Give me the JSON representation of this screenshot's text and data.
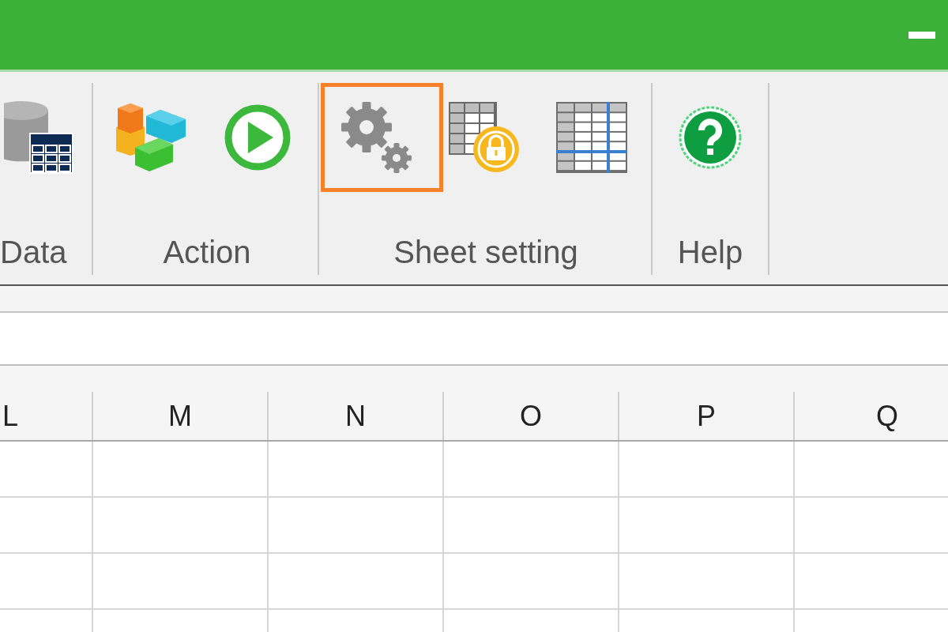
{
  "title_bar": {
    "controls": [
      {
        "kind": "minimize"
      }
    ]
  },
  "ribbon": {
    "groups": [
      {
        "label": "Data",
        "buttons": [
          {
            "kind": "database-table",
            "highlighted": false
          }
        ]
      },
      {
        "label": "Action",
        "buttons": [
          {
            "kind": "blocks",
            "highlighted": false
          },
          {
            "kind": "play",
            "highlighted": false
          }
        ]
      },
      {
        "label": "Sheet setting",
        "buttons": [
          {
            "kind": "gears",
            "highlighted": true
          },
          {
            "kind": "table-lock",
            "highlighted": false
          },
          {
            "kind": "table-freeze",
            "highlighted": false
          }
        ]
      },
      {
        "label": "Help",
        "buttons": [
          {
            "kind": "help",
            "highlighted": false
          }
        ]
      }
    ]
  },
  "sheet": {
    "columns": [
      {
        "label": "L"
      },
      {
        "label": "M"
      },
      {
        "label": "N"
      },
      {
        "label": "O"
      },
      {
        "label": "P"
      },
      {
        "label": "Q"
      }
    ]
  }
}
